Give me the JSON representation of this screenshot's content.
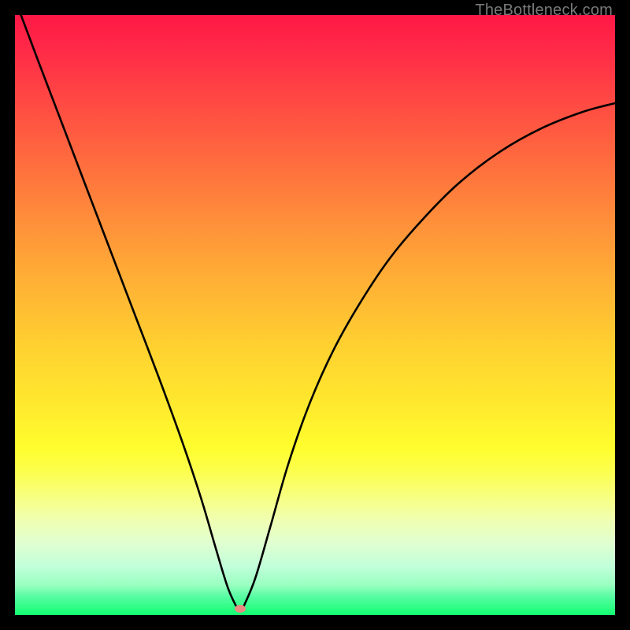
{
  "watermark": "TheBottleneck.com",
  "chart_data": {
    "type": "line",
    "title": "",
    "xlabel": "",
    "ylabel": "",
    "x_range": [
      0,
      1
    ],
    "y_range": [
      0,
      1
    ],
    "note": "Black curve on rainbow gradient. Two branches meeting at a minimum near x≈0.37, y≈0. Left branch is near-linear from top-left to minimum; right branch is convex rising to ~0.85 at x=1. Values are in normalized axis units (fractions of plot area).",
    "series": [
      {
        "name": "left-branch",
        "x": [
          0.01,
          0.04,
          0.08,
          0.12,
          0.16,
          0.2,
          0.24,
          0.28,
          0.31,
          0.335,
          0.355,
          0.37
        ],
        "y": [
          1.0,
          0.92,
          0.815,
          0.71,
          0.605,
          0.5,
          0.395,
          0.285,
          0.195,
          0.11,
          0.045,
          0.012
        ]
      },
      {
        "name": "right-branch",
        "x": [
          0.38,
          0.4,
          0.425,
          0.455,
          0.49,
          0.53,
          0.575,
          0.625,
          0.68,
          0.74,
          0.805,
          0.875,
          0.945,
          1.0
        ],
        "y": [
          0.012,
          0.06,
          0.145,
          0.25,
          0.35,
          0.44,
          0.52,
          0.595,
          0.66,
          0.72,
          0.77,
          0.81,
          0.838,
          0.853
        ]
      }
    ],
    "marker": {
      "x": 0.375,
      "y": 0.01,
      "color": "#e88b82"
    },
    "background": {
      "type": "vertical-gradient",
      "stops": [
        {
          "pos": 0.0,
          "color": "#ff1846"
        },
        {
          "pos": 0.5,
          "color": "#ffc633"
        },
        {
          "pos": 0.75,
          "color": "#fffc3a"
        },
        {
          "pos": 1.0,
          "color": "#12ff70"
        }
      ]
    }
  }
}
